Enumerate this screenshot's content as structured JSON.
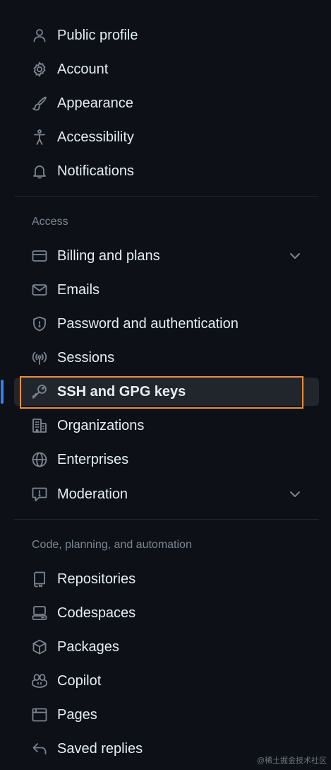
{
  "top_items": [
    {
      "label": "Public profile",
      "icon": "person-icon"
    },
    {
      "label": "Account",
      "icon": "gear-icon"
    },
    {
      "label": "Appearance",
      "icon": "paintbrush-icon"
    },
    {
      "label": "Accessibility",
      "icon": "accessibility-icon"
    },
    {
      "label": "Notifications",
      "icon": "bell-icon"
    }
  ],
  "access": {
    "title": "Access",
    "items": [
      {
        "label": "Billing and plans",
        "icon": "credit-card-icon",
        "expandable": true
      },
      {
        "label": "Emails",
        "icon": "mail-icon"
      },
      {
        "label": "Password and authentication",
        "icon": "shield-icon"
      },
      {
        "label": "Sessions",
        "icon": "broadcast-icon"
      },
      {
        "label": "SSH and GPG keys",
        "icon": "key-icon",
        "active": true
      },
      {
        "label": "Organizations",
        "icon": "organization-icon"
      },
      {
        "label": "Enterprises",
        "icon": "globe-icon"
      },
      {
        "label": "Moderation",
        "icon": "report-icon",
        "expandable": true
      }
    ]
  },
  "code": {
    "title": "Code, planning, and automation",
    "items": [
      {
        "label": "Repositories",
        "icon": "repo-icon"
      },
      {
        "label": "Codespaces",
        "icon": "codespaces-icon"
      },
      {
        "label": "Packages",
        "icon": "package-icon"
      },
      {
        "label": "Copilot",
        "icon": "copilot-icon"
      },
      {
        "label": "Pages",
        "icon": "browser-icon"
      },
      {
        "label": "Saved replies",
        "icon": "reply-icon"
      }
    ]
  },
  "watermark": "@稀土掘金技术社区",
  "colors": {
    "background": "#0d1117",
    "text": "#e6edf3",
    "muted": "#7d8590",
    "active_bg": "#21262d",
    "active_bar": "#2f81f7",
    "highlight_border": "#e88f3b"
  }
}
